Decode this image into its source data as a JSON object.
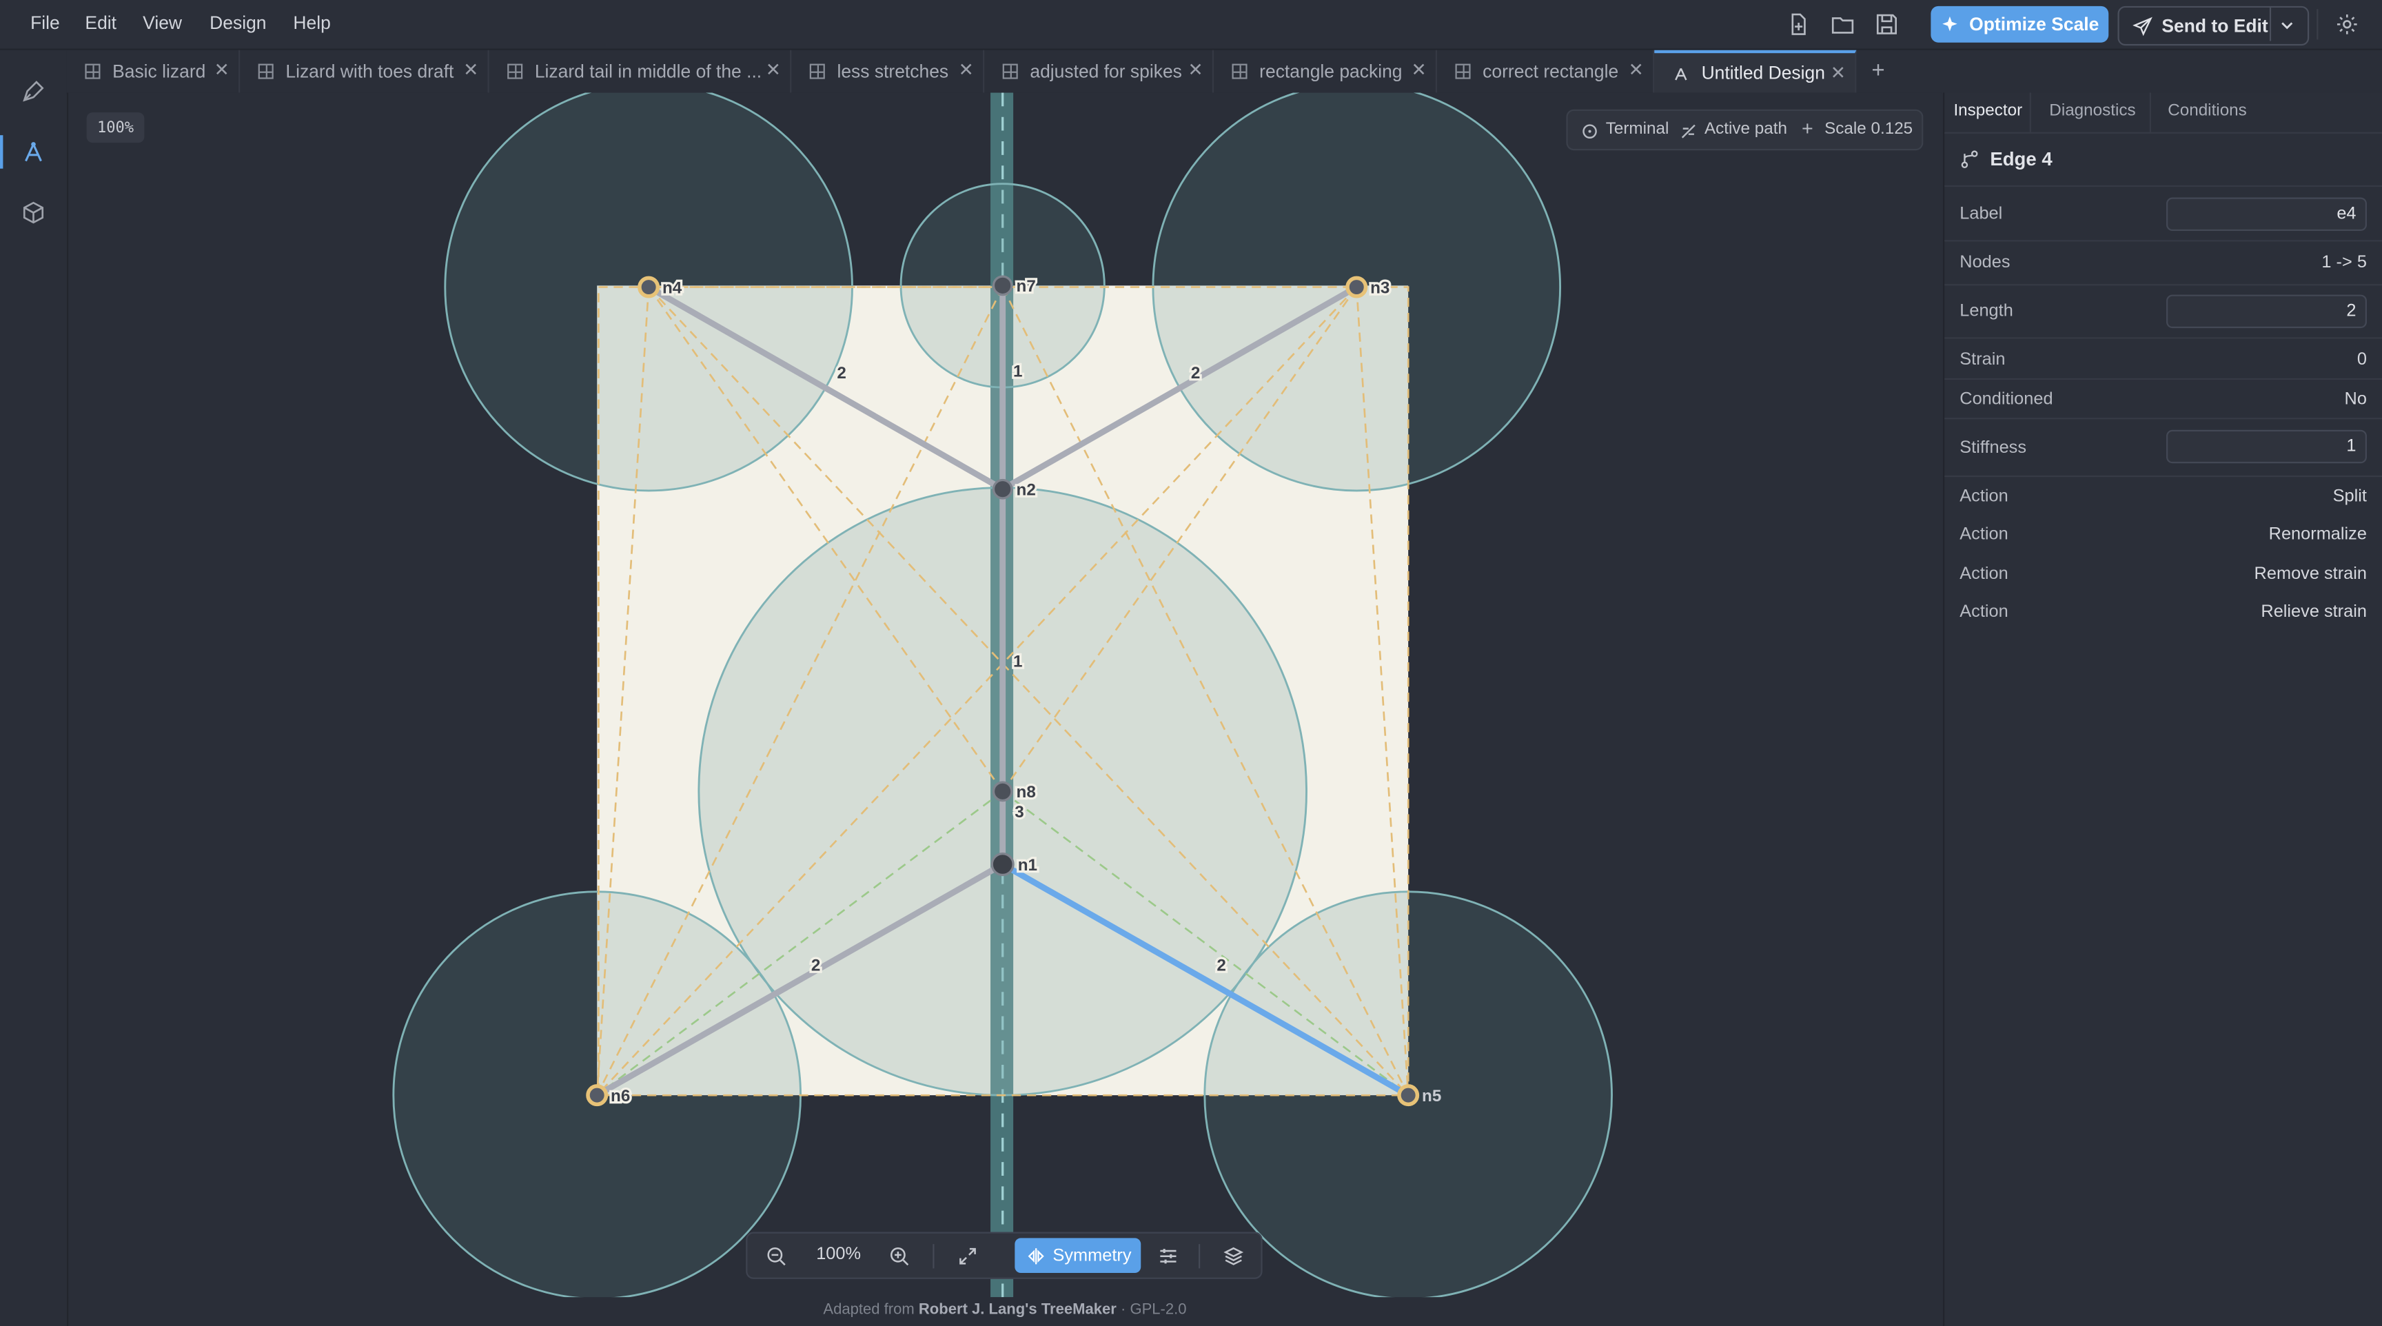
{
  "menu": {
    "file": "File",
    "edit": "Edit",
    "view": "View",
    "design": "Design",
    "help": "Help"
  },
  "toolbar": {
    "optimize_label": "Optimize Scale",
    "send_label": "Send to Edit"
  },
  "tabs": [
    {
      "label": "Basic lizard"
    },
    {
      "label": "Lizard with toes draft"
    },
    {
      "label": "Lizard tail in middle of the ..."
    },
    {
      "label": "less stretches"
    },
    {
      "label": "adjusted for spikes"
    },
    {
      "label": "rectangle packing"
    },
    {
      "label": "correct rectangle"
    },
    {
      "label": "Untitled Design",
      "active": true
    }
  ],
  "canvas": {
    "zoom_chip": "100%",
    "info": {
      "terminal": "Terminal",
      "active_path": "Active path",
      "scale": "Scale 0.125"
    },
    "nodes": [
      "n4",
      "n7",
      "n3",
      "n2",
      "n8",
      "n1",
      "n6",
      "n5"
    ],
    "edge_labels": [
      "2",
      "1",
      "2",
      "1",
      "3",
      "2",
      "2"
    ],
    "colors": {
      "paper": "#f3f1e8",
      "circle": "#5d8f93",
      "edge": "#a9acb6",
      "selected_edge": "#6aa9ea",
      "node_ring": "#e7c277",
      "dash": "#e3bd78",
      "dash_green": "#9cc98a"
    }
  },
  "bottom_toolbar": {
    "zoom": "100%",
    "symmetry_label": "Symmetry"
  },
  "footer": {
    "prefix": "Adapted from",
    "author": "Robert J. Lang's TreeMaker",
    "license": "· GPL-2.0"
  },
  "panel": {
    "tabs": {
      "inspector": "Inspector",
      "diagnostics": "Diagnostics",
      "conditions": "Conditions"
    },
    "title": "Edge 4",
    "rows": {
      "label_k": "Label",
      "label_v": "e4",
      "nodes_k": "Nodes",
      "nodes_v": "1 -> 5",
      "length_k": "Length",
      "length_v": "2",
      "strain_k": "Strain",
      "strain_v": "0",
      "conditioned_k": "Conditioned",
      "conditioned_v": "No",
      "stiffness_k": "Stiffness",
      "stiffness_v": "1"
    },
    "actions": [
      {
        "k": "Action",
        "v": "Split"
      },
      {
        "k": "Action",
        "v": "Renormalize"
      },
      {
        "k": "Action",
        "v": "Remove strain"
      },
      {
        "k": "Action",
        "v": "Relieve strain"
      }
    ]
  }
}
